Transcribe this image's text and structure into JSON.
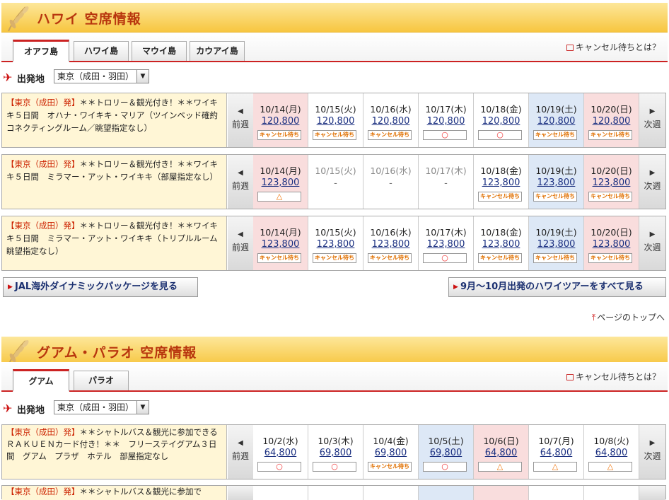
{
  "hawaii": {
    "title": "ハワイ 空席情報",
    "tabs": [
      "オアフ島",
      "ハワイ島",
      "マウイ島",
      "カウアイ島"
    ],
    "cancel_link": "キャンセル待ちとは？",
    "origin_label": "出発地",
    "origin_value": "東京（成田・羽田）",
    "prev": "前週",
    "next": "次週",
    "tours": [
      {
        "origin": "【東京（成田）発】",
        "text": "＊＊トロリー＆観光付き！＊＊ワイキキ５日間　オハナ・ワイキキ・マリア（ツインベッド確約コネクティングルーム／眺望指定なし）",
        "days": [
          {
            "date": "10/14(月)",
            "price": "120,800",
            "status": "キャンセル待ち"
          },
          {
            "date": "10/15(火)",
            "price": "120,800",
            "status": "キャンセル待ち"
          },
          {
            "date": "10/16(水)",
            "price": "120,800",
            "status": "キャンセル待ち"
          },
          {
            "date": "10/17(木)",
            "price": "120,800",
            "status": "○"
          },
          {
            "date": "10/18(金)",
            "price": "120,800",
            "status": "○"
          },
          {
            "date": "10/19(土)",
            "price": "120,800",
            "status": "キャンセル待ち"
          },
          {
            "date": "10/20(日)",
            "price": "120,800",
            "status": "キャンセル待ち"
          }
        ]
      },
      {
        "origin": "【東京（成田）発】",
        "text": "＊＊トロリー＆観光付き！＊＊ワイキキ５日間　ミラマー・アット・ワイキキ（部屋指定なし）",
        "days": [
          {
            "date": "10/14(月)",
            "price": "123,800",
            "status": "△"
          },
          {
            "date": "10/15(火)",
            "price": "",
            "status": "-"
          },
          {
            "date": "10/16(水)",
            "price": "",
            "status": "-"
          },
          {
            "date": "10/17(木)",
            "price": "",
            "status": "-"
          },
          {
            "date": "10/18(金)",
            "price": "123,800",
            "status": "キャンセル待ち"
          },
          {
            "date": "10/19(土)",
            "price": "123,800",
            "status": "キャンセル待ち"
          },
          {
            "date": "10/20(日)",
            "price": "123,800",
            "status": "キャンセル待ち"
          }
        ]
      },
      {
        "origin": "【東京（成田）発】",
        "text": "＊＊トロリー＆観光付き！＊＊ワイキキ５日間　ミラマー・アット・ワイキキ（トリプルルーム眺望指定なし）",
        "days": [
          {
            "date": "10/14(月)",
            "price": "123,800",
            "status": "キャンセル待ち"
          },
          {
            "date": "10/15(火)",
            "price": "123,800",
            "status": "キャンセル待ち"
          },
          {
            "date": "10/16(水)",
            "price": "123,800",
            "status": "キャンセル待ち"
          },
          {
            "date": "10/17(木)",
            "price": "123,800",
            "status": "○"
          },
          {
            "date": "10/18(金)",
            "price": "123,800",
            "status": "キャンセル待ち"
          },
          {
            "date": "10/19(土)",
            "price": "123,800",
            "status": "キャンセル待ち"
          },
          {
            "date": "10/20(日)",
            "price": "123,800",
            "status": "キャンセル待ち"
          }
        ]
      }
    ],
    "btn_left": "JAL海外ダイナミックパッケージを見る",
    "btn_right": "9月～10月出発のハワイツアーをすべて見る",
    "page_top": "ページのトップへ"
  },
  "guam": {
    "title": "グアム・パラオ 空席情報",
    "tabs": [
      "グアム",
      "パラオ"
    ],
    "cancel_link": "キャンセル待ちとは？",
    "origin_label": "出発地",
    "origin_value": "東京（成田・羽田）",
    "prev": "前週",
    "next": "次週",
    "tours": [
      {
        "origin": "【東京（成田）発】",
        "text": "＊＊シャトルバス＆観光に参加できるＲＡＫＵＥＮカード付き！＊＊　フリーステイグアム３日間　グアム　プラザ　ホテル　部屋指定なし",
        "days": [
          {
            "date": "10/2(水)",
            "price": "64,800",
            "status": "○"
          },
          {
            "date": "10/3(木)",
            "price": "69,800",
            "status": "○"
          },
          {
            "date": "10/4(金)",
            "price": "69,800",
            "status": "キャンセル待ち"
          },
          {
            "date": "10/5(土)",
            "price": "69,800",
            "status": "○"
          },
          {
            "date": "10/6(日)",
            "price": "64,800",
            "status": "△"
          },
          {
            "date": "10/7(月)",
            "price": "64,800",
            "status": "△"
          },
          {
            "date": "10/8(火)",
            "price": "64,800",
            "status": "△"
          }
        ]
      },
      {
        "origin": "【東京（成田）発】",
        "text": "＊＊シャトルバス＆観光に参加で",
        "days": []
      }
    ]
  }
}
